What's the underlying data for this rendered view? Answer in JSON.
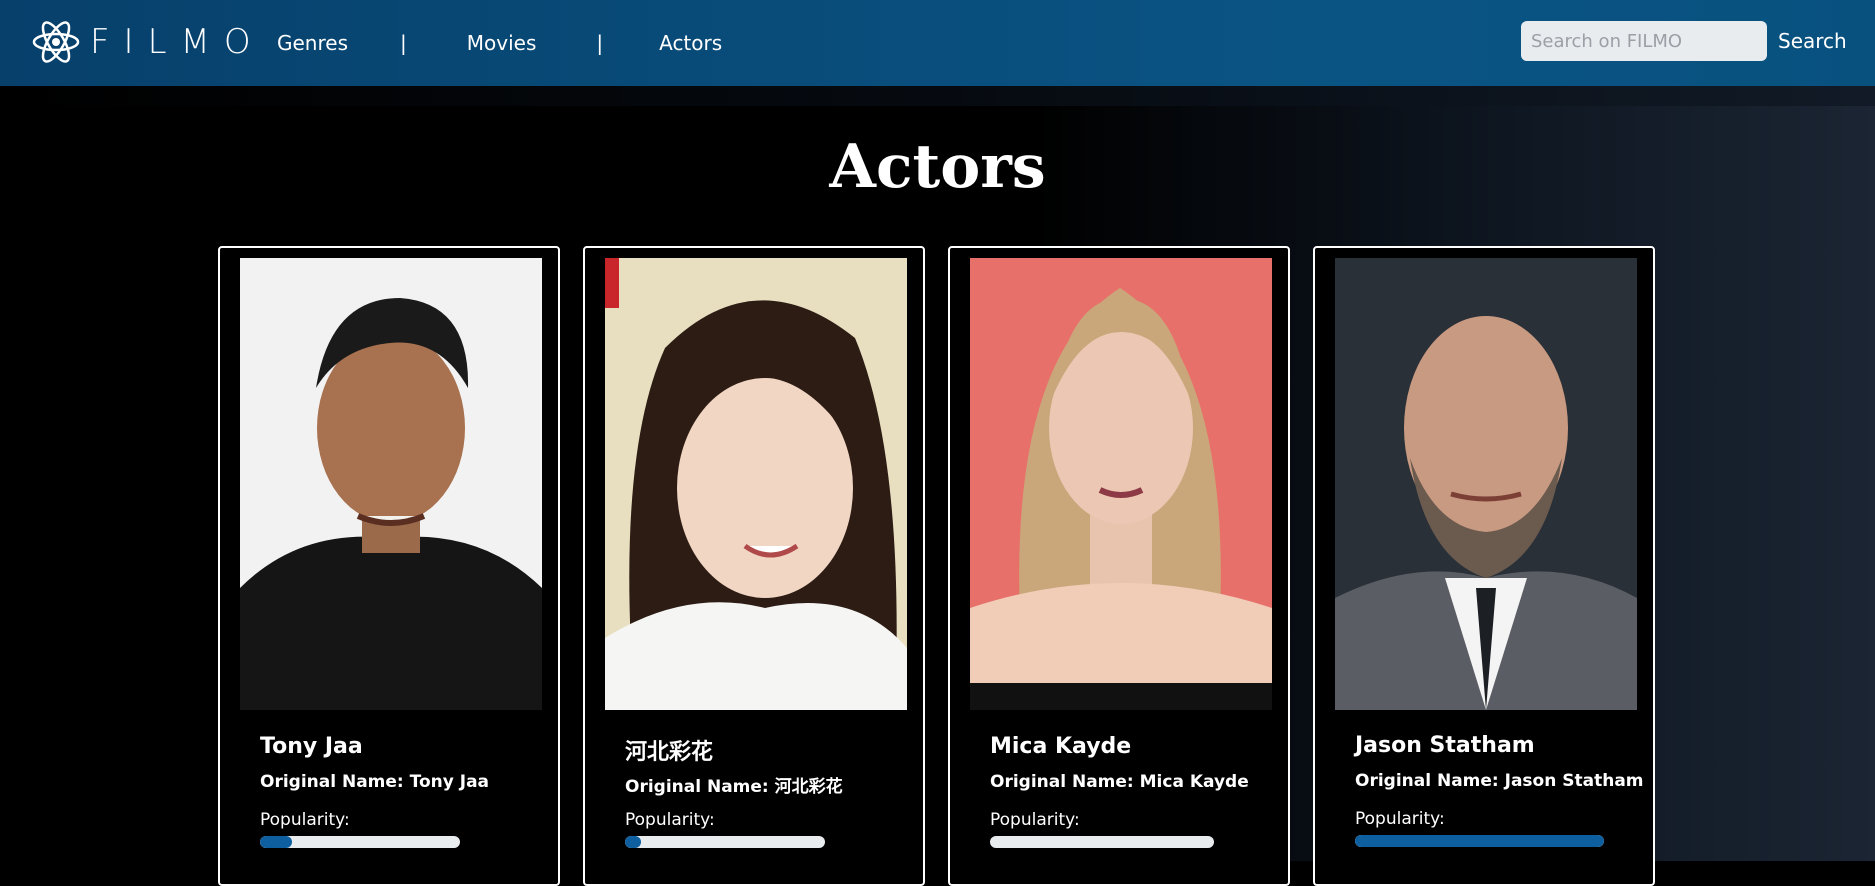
{
  "brand": {
    "name": "FILMO"
  },
  "nav": {
    "links": [
      "Genres",
      "Movies",
      "Actors"
    ],
    "separator": "|"
  },
  "search": {
    "placeholder": "Search on FILMO",
    "button_label": "Search"
  },
  "page": {
    "title": "Actors"
  },
  "actors": [
    {
      "name": "Tony Jaa",
      "original_name_label": "Original Name: Tony Jaa",
      "popularity_label": "Popularity:",
      "popularity_fraction": 0.16,
      "photo_bg": "#f2f2f2"
    },
    {
      "name": "河北彩花",
      "original_name_label": "Original Name: 河北彩花",
      "popularity_label": "Popularity:",
      "popularity_fraction": 0.08,
      "photo_bg": "#e8dfc0"
    },
    {
      "name": "Mica Kayde",
      "original_name_label": "Original Name: Mica Kayde",
      "popularity_label": "Popularity:",
      "popularity_fraction": 0.0,
      "photo_bg": "#e8706a"
    },
    {
      "name": "Jason Statham",
      "original_name_label": "Original Name: Jason Statham",
      "popularity_label": "Popularity:",
      "popularity_fraction": 1.0,
      "photo_bg": "#2a3038"
    }
  ],
  "colors": {
    "navbar": "#0a5484",
    "accent": "#0d5fa0",
    "track": "#e9ecef"
  }
}
